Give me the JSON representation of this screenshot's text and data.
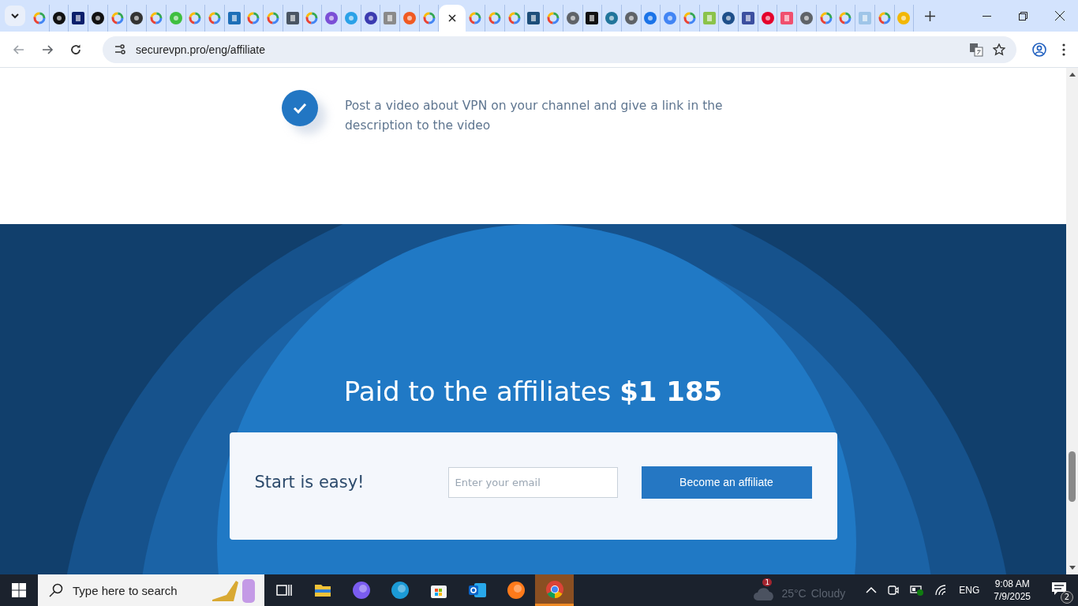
{
  "browser": {
    "tabs": [
      {
        "kind": "google",
        "selected": false
      },
      {
        "kind": "round",
        "color": "#111111",
        "selected": false
      },
      {
        "kind": "square",
        "color": "#0b1f6b",
        "selected": false
      },
      {
        "kind": "round",
        "color": "#111111",
        "selected": false
      },
      {
        "kind": "google",
        "selected": false
      },
      {
        "kind": "round",
        "color": "#333333",
        "selected": false
      },
      {
        "kind": "google",
        "selected": false
      },
      {
        "kind": "round",
        "color": "#3fbf3f",
        "selected": false
      },
      {
        "kind": "google",
        "selected": false
      },
      {
        "kind": "google",
        "selected": false
      },
      {
        "kind": "square",
        "color": "#1e6fb8",
        "selected": false
      },
      {
        "kind": "google",
        "selected": false
      },
      {
        "kind": "google",
        "selected": false
      },
      {
        "kind": "square",
        "color": "#4a5563",
        "selected": false
      },
      {
        "kind": "google",
        "selected": false
      },
      {
        "kind": "round",
        "color": "#7b4fd6",
        "selected": false
      },
      {
        "kind": "round",
        "color": "#2aa1e8",
        "selected": false
      },
      {
        "kind": "round",
        "color": "#3b3bb0",
        "selected": false
      },
      {
        "kind": "square",
        "color": "#8a8a8a",
        "selected": false
      },
      {
        "kind": "round",
        "color": "#f05a22",
        "selected": false
      },
      {
        "kind": "google",
        "selected": false
      },
      {
        "kind": "none",
        "selected": true
      },
      {
        "kind": "google",
        "selected": false
      },
      {
        "kind": "google",
        "selected": false
      },
      {
        "kind": "google",
        "selected": false
      },
      {
        "kind": "square",
        "color": "#1d4e7a",
        "selected": false
      },
      {
        "kind": "google",
        "selected": false
      },
      {
        "kind": "round",
        "color": "#5f6368",
        "selected": false
      },
      {
        "kind": "square",
        "color": "#111111",
        "selected": false
      },
      {
        "kind": "round",
        "color": "#21759b",
        "selected": false
      },
      {
        "kind": "round",
        "color": "#5f6368",
        "selected": false
      },
      {
        "kind": "round",
        "color": "#1a73e8",
        "selected": false
      },
      {
        "kind": "round",
        "color": "#4285f4",
        "selected": false
      },
      {
        "kind": "google",
        "selected": false
      },
      {
        "kind": "square",
        "color": "#8bc34a",
        "selected": false
      },
      {
        "kind": "round",
        "color": "#1e4f8a",
        "selected": false
      },
      {
        "kind": "square",
        "color": "#3c4fa0",
        "selected": false
      },
      {
        "kind": "round",
        "color": "#e4002b",
        "selected": false
      },
      {
        "kind": "square",
        "color": "#f0506e",
        "selected": false
      },
      {
        "kind": "round",
        "color": "#5f6368",
        "selected": false
      },
      {
        "kind": "google",
        "selected": false
      },
      {
        "kind": "google",
        "selected": false
      },
      {
        "kind": "square",
        "color": "#9fc5e8",
        "selected": false
      },
      {
        "kind": "google",
        "selected": false
      },
      {
        "kind": "round",
        "color": "#f2b705",
        "selected": false
      }
    ],
    "url": "securevpn.pro/eng/affiliate"
  },
  "page": {
    "step": {
      "text": "Post a video about VPN on your channel and give a link in the description to the video",
      "checked": true
    },
    "headline": "Paid to the affiliates **$1 185**",
    "signup": {
      "title": "Start is easy!",
      "email_placeholder": "Enter your email",
      "button": "Become an affiliate"
    }
  },
  "taskbar": {
    "search_placeholder": "Type here to search",
    "apps": [
      {
        "kind": "taskview",
        "selected": false
      },
      {
        "kind": "explorer",
        "selected": false
      },
      {
        "kind": "copilot",
        "selected": false
      },
      {
        "kind": "edge",
        "selected": false
      },
      {
        "kind": "store",
        "selected": false
      },
      {
        "kind": "outlook",
        "selected": false
      },
      {
        "kind": "firefox",
        "selected": false
      },
      {
        "kind": "chrome",
        "selected": true
      }
    ],
    "weather": {
      "temperature": "25°C",
      "condition": "Cloudy",
      "badge": "1"
    },
    "language": "ENG",
    "time": "9:08 AM",
    "date": "7/9/2025",
    "notifications": "2"
  }
}
